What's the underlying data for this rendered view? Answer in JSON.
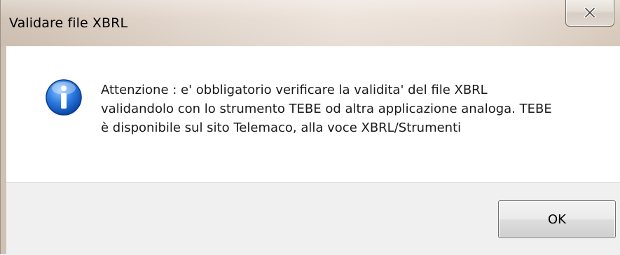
{
  "window": {
    "title": "Validare file XBRL",
    "close_icon": "close-icon"
  },
  "message": {
    "icon": "info-icon",
    "lines": [
      "Attenzione : e' obbligatorio verificare la validita' del file XBRL",
      "validandolo con lo strumento TEBE od altra applicazione analoga. TEBE",
      "è disponibile sul sito Telemaco, alla voce XBRL/Strumenti"
    ]
  },
  "buttons": {
    "ok_label": "OK"
  },
  "colors": {
    "icon_blue": "#1f6fd0",
    "content_bg": "#ffffff",
    "footer_bg": "#f0f0f0"
  }
}
